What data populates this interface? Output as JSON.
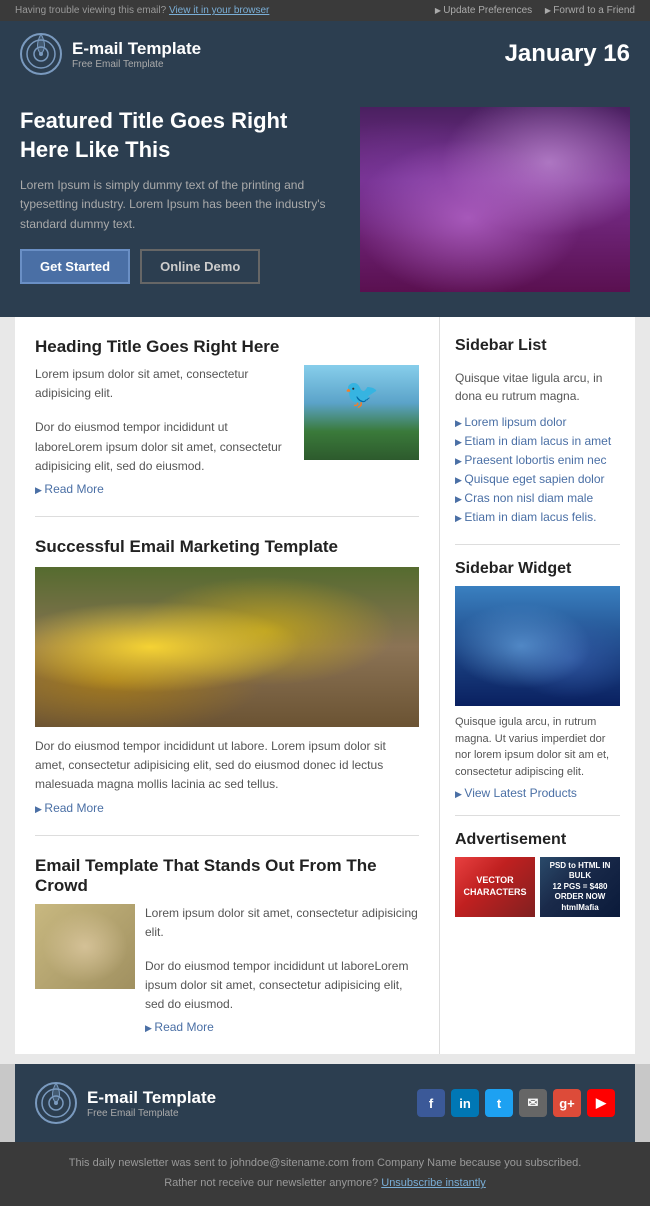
{
  "topbar": {
    "left_text": "Having trouble viewing this email?",
    "left_link": "View it in your browser",
    "right_link1": "Update Preferences",
    "right_link2": "Forwrd to a Friend"
  },
  "header": {
    "logo_title": "E-mail Template",
    "logo_subtitle": "Free Email Template",
    "date": "January 16"
  },
  "hero": {
    "title": "Featured Title Goes Right Here Like This",
    "description": "Lorem Ipsum is simply dummy text of the printing and typesetting industry. Lorem Ipsum has been the industry's standard dummy text.",
    "btn_primary": "Get Started",
    "btn_secondary": "Online Demo"
  },
  "main": {
    "article1": {
      "heading": "Heading Title Goes Right Here",
      "text1": "Lorem ipsum dolor sit amet, consectetur adipisicing elit.",
      "text2": "Dor do eiusmod tempor incididunt ut laboreLorem ipsum dolor sit amet, consectetur adipisicing elit, sed do eiusmod.",
      "read_more": "Read More"
    },
    "article2": {
      "heading": "Successful Email Marketing Template",
      "text": "Dor do eiusmod tempor incididunt ut labore. Lorem ipsum dolor sit amet, consectetur adipisicing elit, sed do eiusmod donec id lectus malesuada magna mollis lacinia ac sed tellus.",
      "read_more": "Read More"
    },
    "article3": {
      "heading": "Email Template That Stands Out From The Crowd",
      "text1": "Lorem ipsum dolor sit amet, consectetur adipisicing elit.",
      "text2": "Dor do eiusmod tempor incididunt ut laboreLorem ipsum dolor sit amet, consectetur adipisicing elit, sed do eiusmod.",
      "read_more": "Read More"
    }
  },
  "sidebar": {
    "list_heading": "Sidebar List",
    "list_desc": "Quisque vitae ligula arcu, in dona eu rutrum magna.",
    "list_items": [
      "Lorem lipsum dolor",
      "Etiam in diam lacus in amet",
      "Praesent lobortis enim nec",
      "Quisque eget sapien dolor",
      "Cras non nisl diam male",
      "Etiam in diam lacus felis."
    ],
    "widget_heading": "Sidebar Widget",
    "widget_text": "Quisque igula arcu, in rutrum magna. Ut varius imperdiet dor nor lorem ipsum dolor sit am et, consectetur adipiscing elit.",
    "view_products": "View Latest Products",
    "ad_heading": "Advertisement",
    "ad1_text": "VECTOR\nCHARACTERS",
    "ad2_text": "PSD to HTML IN BULK\n12 PGS = $480  ORDER NOW\nhtmlMafia"
  },
  "footer": {
    "logo_title": "E-mail Template",
    "logo_subtitle": "Free Email Template",
    "social_icons": [
      "f",
      "in",
      "t",
      "✉",
      "g+",
      "▶"
    ],
    "bottom_text1": "This daily newsletter was sent to johndoe@sitename.com from Company Name because you subscribed.",
    "bottom_text2": "Rather not receive our newsletter anymore?",
    "unsubscribe": "Unsubscribe instantly"
  }
}
